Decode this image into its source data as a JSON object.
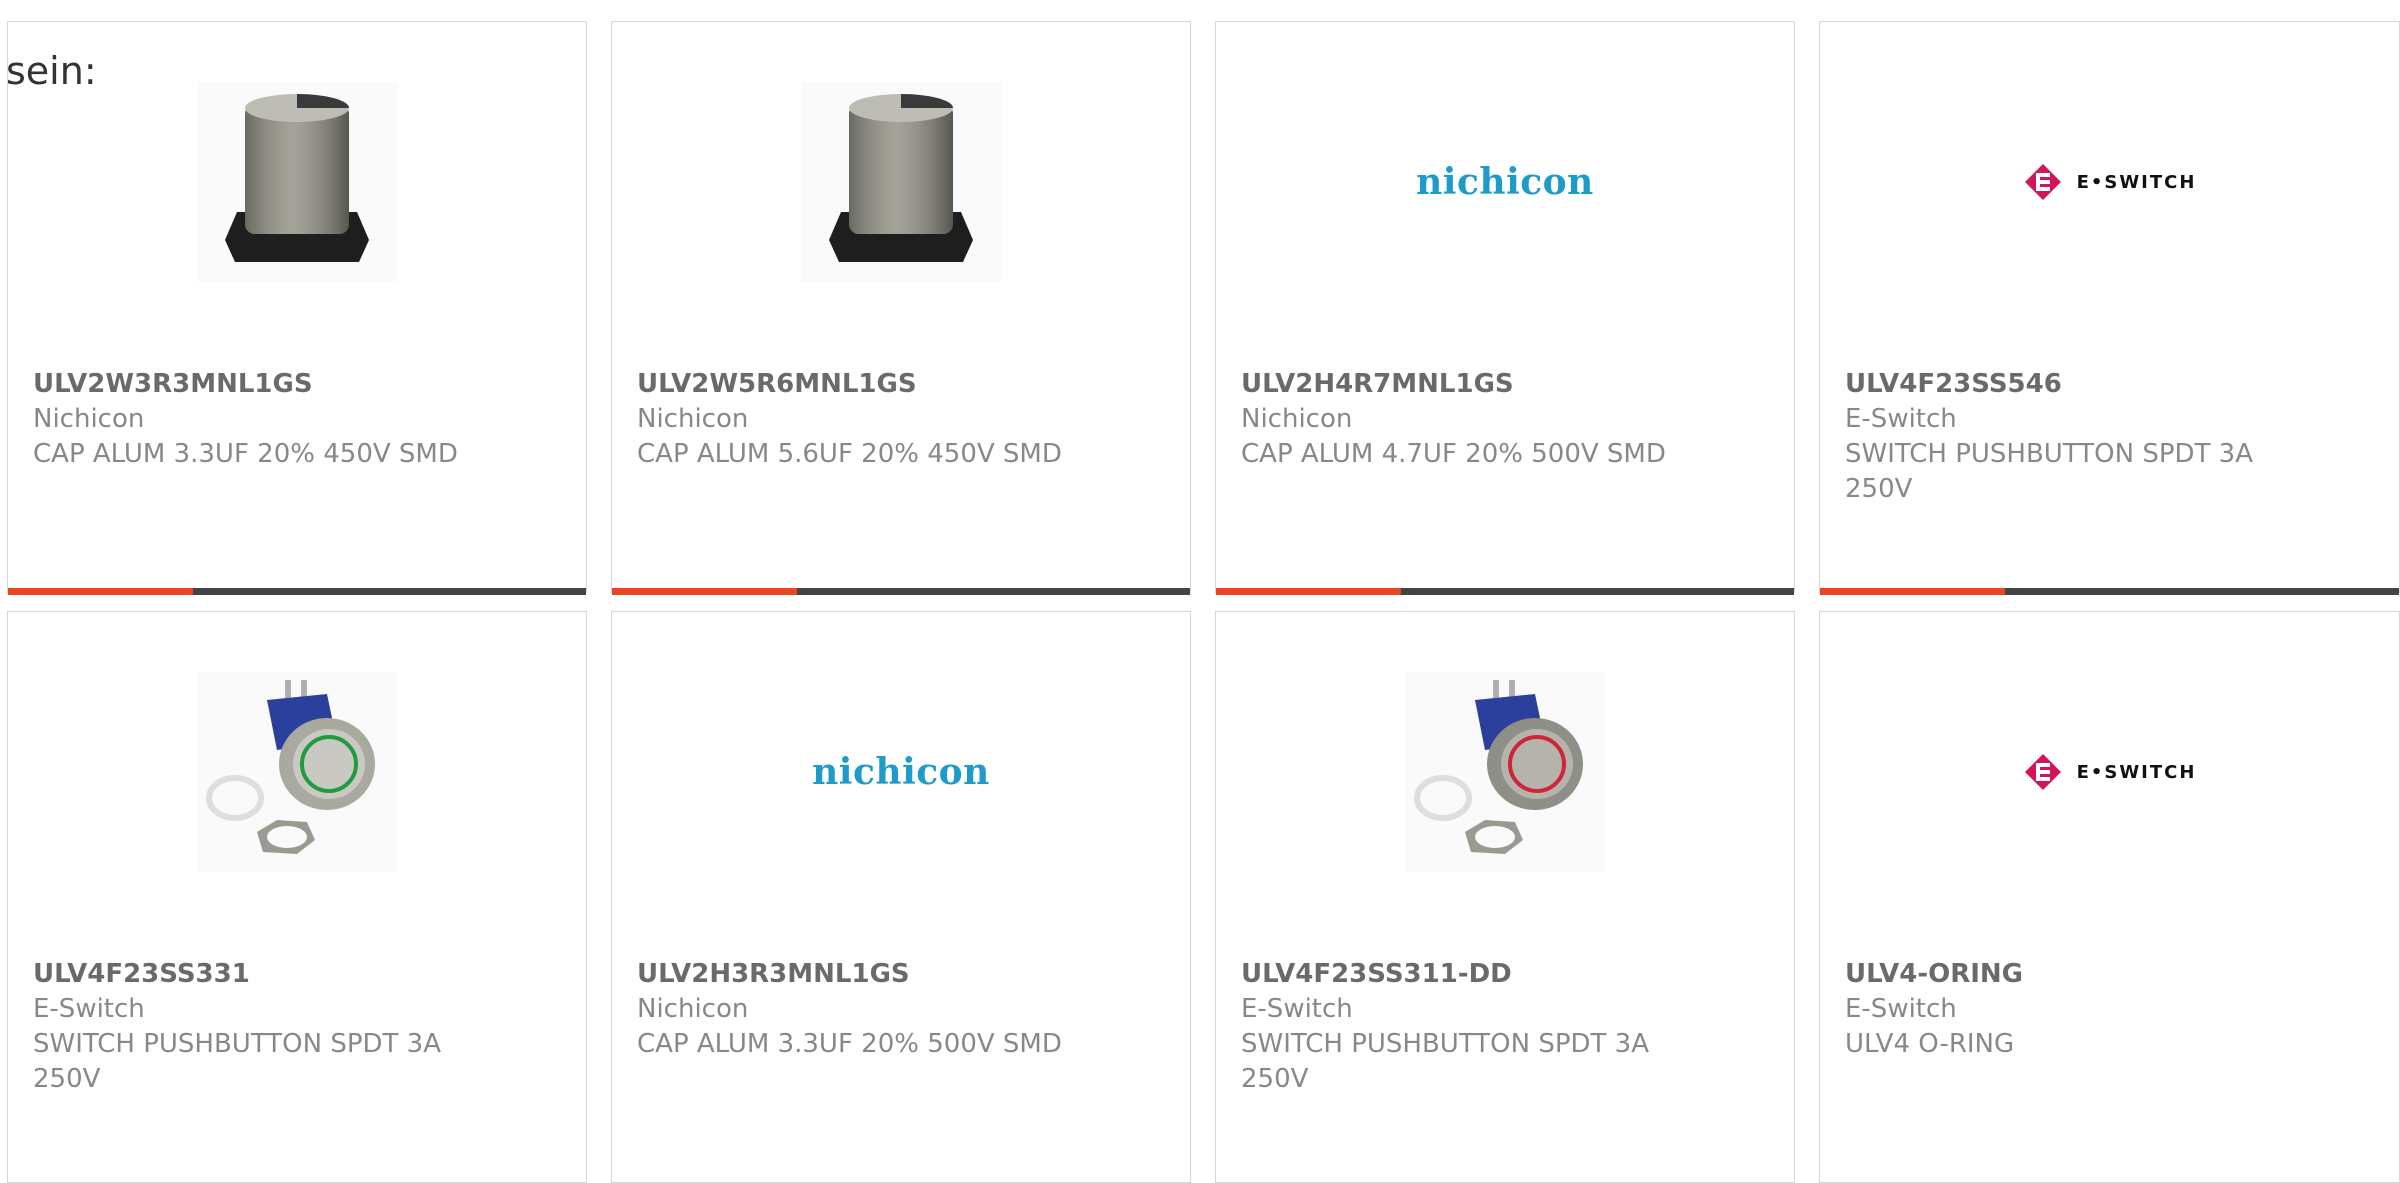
{
  "intro": {
    "text": "sein:"
  },
  "colors": {
    "accent": "#e8461e",
    "track": "#444444",
    "nichicon_blue": "#1f9bc9",
    "eswitch_magenta": "#d2145a"
  },
  "cards": [
    {
      "part_number": "ULV2W3R3MNL1GS",
      "manufacturer": "Nichicon",
      "description": "CAP ALUM 3.3UF 20% 450V SMD",
      "image": "capacitor-smd-photo",
      "progress": 0.32
    },
    {
      "part_number": "ULV2W5R6MNL1GS",
      "manufacturer": "Nichicon",
      "description": "CAP ALUM 5.6UF 20% 450V SMD",
      "image": "capacitor-smd-photo",
      "progress": 0.32
    },
    {
      "part_number": "ULV2H4R7MNL1GS",
      "manufacturer": "Nichicon",
      "description": "CAP ALUM 4.7UF 20% 500V SMD",
      "image": "nichicon-logo",
      "logo_text": "nichicon",
      "progress": 0.32
    },
    {
      "part_number": "ULV4F23SS546",
      "manufacturer": "E-Switch",
      "description": "SWITCH PUSHBUTTON SPDT 3A 250V",
      "image": "eswitch-logo",
      "logo_text": "E•SWITCH",
      "progress": 0.32
    },
    {
      "part_number": "ULV4F23SS331",
      "manufacturer": "E-Switch",
      "description": "SWITCH PUSHBUTTON SPDT 3A 250V",
      "image": "pushbutton-green-ring-photo"
    },
    {
      "part_number": "ULV2H3R3MNL1GS",
      "manufacturer": "Nichicon",
      "description": "CAP ALUM 3.3UF 20% 500V SMD",
      "image": "nichicon-logo",
      "logo_text": "nichicon"
    },
    {
      "part_number": "ULV4F23SS311-DD",
      "manufacturer": "E-Switch",
      "description": "SWITCH PUSHBUTTON SPDT 3A 250V",
      "image": "pushbutton-red-ring-photo"
    },
    {
      "part_number": "ULV4-ORING",
      "manufacturer": "E-Switch",
      "description": "ULV4 O-RING",
      "image": "eswitch-logo",
      "logo_text": "E•SWITCH"
    }
  ]
}
